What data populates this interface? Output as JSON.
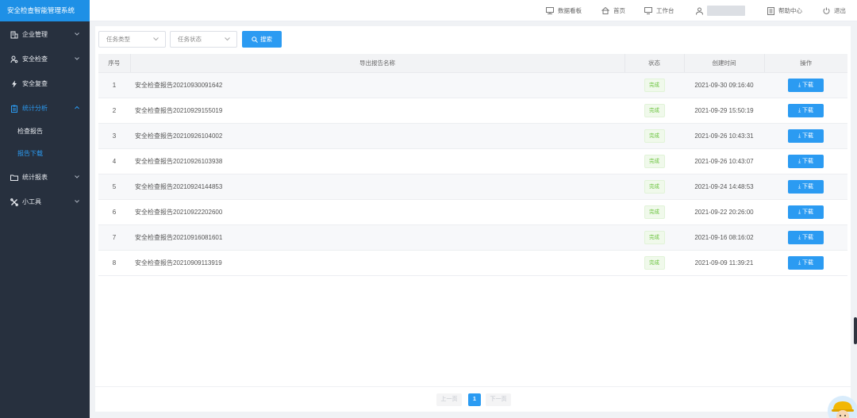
{
  "app": {
    "title": "安全检查智能管理系统"
  },
  "sidebar": {
    "items": [
      {
        "label": "企业管理"
      },
      {
        "label": "安全检查"
      },
      {
        "label": "安全复查"
      },
      {
        "label": "统计分析"
      },
      {
        "label": "统计报表"
      },
      {
        "label": "小工具"
      }
    ],
    "sub_items": [
      {
        "label": "检查报告"
      },
      {
        "label": "报告下载"
      }
    ]
  },
  "header": {
    "dashboard": "数据看板",
    "home": "首页",
    "workbench": "工作台",
    "help": "帮助中心",
    "logout": "退出"
  },
  "filters": {
    "task_type": "任务类型",
    "task_status": "任务状态",
    "search_label": "搜索"
  },
  "table": {
    "columns": [
      "序号",
      "导出报告名称",
      "状态",
      "创建时间",
      "操作"
    ],
    "download_label": "⤓ 下载",
    "rows": [
      {
        "index": "1",
        "name": "安全检查报告20210930091642",
        "status": "完成",
        "created": "2021-09-30 09:16:40"
      },
      {
        "index": "2",
        "name": "安全检查报告20210929155019",
        "status": "完成",
        "created": "2021-09-29 15:50:19"
      },
      {
        "index": "3",
        "name": "安全检查报告20210926104002",
        "status": "完成",
        "created": "2021-09-26 10:43:31"
      },
      {
        "index": "4",
        "name": "安全检查报告20210926103938",
        "status": "完成",
        "created": "2021-09-26 10:43:07"
      },
      {
        "index": "5",
        "name": "安全检查报告20210924144853",
        "status": "完成",
        "created": "2021-09-24 14:48:53"
      },
      {
        "index": "6",
        "name": "安全检查报告20210922202600",
        "status": "完成",
        "created": "2021-09-22 20:26:00"
      },
      {
        "index": "7",
        "name": "安全检查报告20210916081601",
        "status": "完成",
        "created": "2021-09-16 08:16:02"
      },
      {
        "index": "8",
        "name": "安全检查报告20210909113919",
        "status": "完成",
        "created": "2021-09-09 11:39:21"
      }
    ]
  },
  "pagination": {
    "prev": "上一页",
    "current": "1",
    "next": "下一页"
  },
  "colors": {
    "accent": "#2b9bf2",
    "sidebar": "#27303e",
    "brand": "#1e90e6",
    "success": "#67c23a"
  }
}
